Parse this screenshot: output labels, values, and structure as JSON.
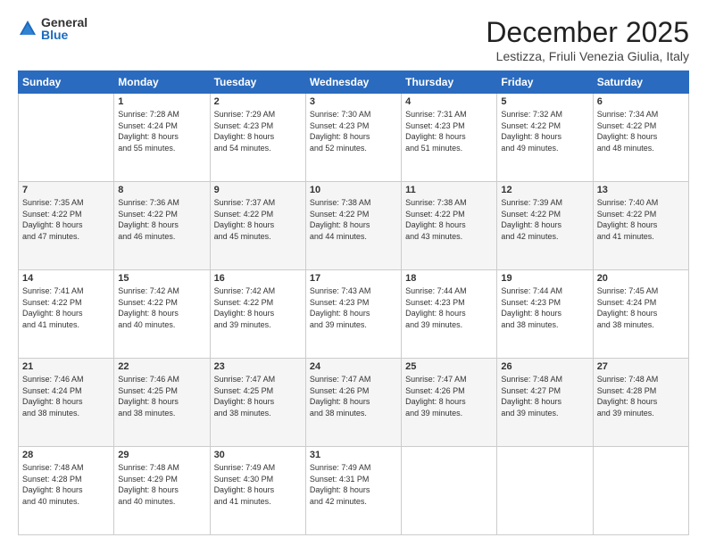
{
  "logo": {
    "general": "General",
    "blue": "Blue"
  },
  "title": "December 2025",
  "subtitle": "Lestizza, Friuli Venezia Giulia, Italy",
  "headers": [
    "Sunday",
    "Monday",
    "Tuesday",
    "Wednesday",
    "Thursday",
    "Friday",
    "Saturday"
  ],
  "weeks": [
    [
      {
        "day": "",
        "info": ""
      },
      {
        "day": "1",
        "info": "Sunrise: 7:28 AM\nSunset: 4:24 PM\nDaylight: 8 hours\nand 55 minutes."
      },
      {
        "day": "2",
        "info": "Sunrise: 7:29 AM\nSunset: 4:23 PM\nDaylight: 8 hours\nand 54 minutes."
      },
      {
        "day": "3",
        "info": "Sunrise: 7:30 AM\nSunset: 4:23 PM\nDaylight: 8 hours\nand 52 minutes."
      },
      {
        "day": "4",
        "info": "Sunrise: 7:31 AM\nSunset: 4:23 PM\nDaylight: 8 hours\nand 51 minutes."
      },
      {
        "day": "5",
        "info": "Sunrise: 7:32 AM\nSunset: 4:22 PM\nDaylight: 8 hours\nand 49 minutes."
      },
      {
        "day": "6",
        "info": "Sunrise: 7:34 AM\nSunset: 4:22 PM\nDaylight: 8 hours\nand 48 minutes."
      }
    ],
    [
      {
        "day": "7",
        "info": "Sunrise: 7:35 AM\nSunset: 4:22 PM\nDaylight: 8 hours\nand 47 minutes."
      },
      {
        "day": "8",
        "info": "Sunrise: 7:36 AM\nSunset: 4:22 PM\nDaylight: 8 hours\nand 46 minutes."
      },
      {
        "day": "9",
        "info": "Sunrise: 7:37 AM\nSunset: 4:22 PM\nDaylight: 8 hours\nand 45 minutes."
      },
      {
        "day": "10",
        "info": "Sunrise: 7:38 AM\nSunset: 4:22 PM\nDaylight: 8 hours\nand 44 minutes."
      },
      {
        "day": "11",
        "info": "Sunrise: 7:38 AM\nSunset: 4:22 PM\nDaylight: 8 hours\nand 43 minutes."
      },
      {
        "day": "12",
        "info": "Sunrise: 7:39 AM\nSunset: 4:22 PM\nDaylight: 8 hours\nand 42 minutes."
      },
      {
        "day": "13",
        "info": "Sunrise: 7:40 AM\nSunset: 4:22 PM\nDaylight: 8 hours\nand 41 minutes."
      }
    ],
    [
      {
        "day": "14",
        "info": "Sunrise: 7:41 AM\nSunset: 4:22 PM\nDaylight: 8 hours\nand 41 minutes."
      },
      {
        "day": "15",
        "info": "Sunrise: 7:42 AM\nSunset: 4:22 PM\nDaylight: 8 hours\nand 40 minutes."
      },
      {
        "day": "16",
        "info": "Sunrise: 7:42 AM\nSunset: 4:22 PM\nDaylight: 8 hours\nand 39 minutes."
      },
      {
        "day": "17",
        "info": "Sunrise: 7:43 AM\nSunset: 4:23 PM\nDaylight: 8 hours\nand 39 minutes."
      },
      {
        "day": "18",
        "info": "Sunrise: 7:44 AM\nSunset: 4:23 PM\nDaylight: 8 hours\nand 39 minutes."
      },
      {
        "day": "19",
        "info": "Sunrise: 7:44 AM\nSunset: 4:23 PM\nDaylight: 8 hours\nand 38 minutes."
      },
      {
        "day": "20",
        "info": "Sunrise: 7:45 AM\nSunset: 4:24 PM\nDaylight: 8 hours\nand 38 minutes."
      }
    ],
    [
      {
        "day": "21",
        "info": "Sunrise: 7:46 AM\nSunset: 4:24 PM\nDaylight: 8 hours\nand 38 minutes."
      },
      {
        "day": "22",
        "info": "Sunrise: 7:46 AM\nSunset: 4:25 PM\nDaylight: 8 hours\nand 38 minutes."
      },
      {
        "day": "23",
        "info": "Sunrise: 7:47 AM\nSunset: 4:25 PM\nDaylight: 8 hours\nand 38 minutes."
      },
      {
        "day": "24",
        "info": "Sunrise: 7:47 AM\nSunset: 4:26 PM\nDaylight: 8 hours\nand 38 minutes."
      },
      {
        "day": "25",
        "info": "Sunrise: 7:47 AM\nSunset: 4:26 PM\nDaylight: 8 hours\nand 39 minutes."
      },
      {
        "day": "26",
        "info": "Sunrise: 7:48 AM\nSunset: 4:27 PM\nDaylight: 8 hours\nand 39 minutes."
      },
      {
        "day": "27",
        "info": "Sunrise: 7:48 AM\nSunset: 4:28 PM\nDaylight: 8 hours\nand 39 minutes."
      }
    ],
    [
      {
        "day": "28",
        "info": "Sunrise: 7:48 AM\nSunset: 4:28 PM\nDaylight: 8 hours\nand 40 minutes."
      },
      {
        "day": "29",
        "info": "Sunrise: 7:48 AM\nSunset: 4:29 PM\nDaylight: 8 hours\nand 40 minutes."
      },
      {
        "day": "30",
        "info": "Sunrise: 7:49 AM\nSunset: 4:30 PM\nDaylight: 8 hours\nand 41 minutes."
      },
      {
        "day": "31",
        "info": "Sunrise: 7:49 AM\nSunset: 4:31 PM\nDaylight: 8 hours\nand 42 minutes."
      },
      {
        "day": "",
        "info": ""
      },
      {
        "day": "",
        "info": ""
      },
      {
        "day": "",
        "info": ""
      }
    ]
  ]
}
